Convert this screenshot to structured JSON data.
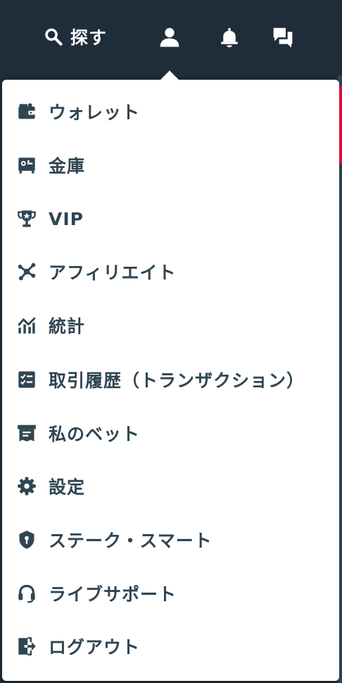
{
  "topbar": {
    "search_label": "探す",
    "icons": [
      "search-icon",
      "user-icon",
      "bell-icon",
      "chat-icon"
    ]
  },
  "colors": {
    "topbar_bg": "#1f2d3b",
    "menu_bg": "#ffffff",
    "text": "#2f4553",
    "accent": "#e9113c"
  },
  "menu": {
    "items": [
      {
        "label": "ウォレット",
        "icon": "wallet-icon"
      },
      {
        "label": "金庫",
        "icon": "safe-icon"
      },
      {
        "label": "VIP",
        "icon": "trophy-icon"
      },
      {
        "label": "アフィリエイト",
        "icon": "network-icon"
      },
      {
        "label": "統計",
        "icon": "stats-chart-icon"
      },
      {
        "label": "取引履歴（トランザクション）",
        "icon": "checklist-icon"
      },
      {
        "label": "私のベット",
        "icon": "bet-slip-icon"
      },
      {
        "label": "設定",
        "icon": "gear-icon"
      },
      {
        "label": "ステーク・スマート",
        "icon": "shield-icon"
      },
      {
        "label": "ライブサポート",
        "icon": "headset-icon"
      },
      {
        "label": "ログアウト",
        "icon": "logout-icon"
      }
    ]
  }
}
